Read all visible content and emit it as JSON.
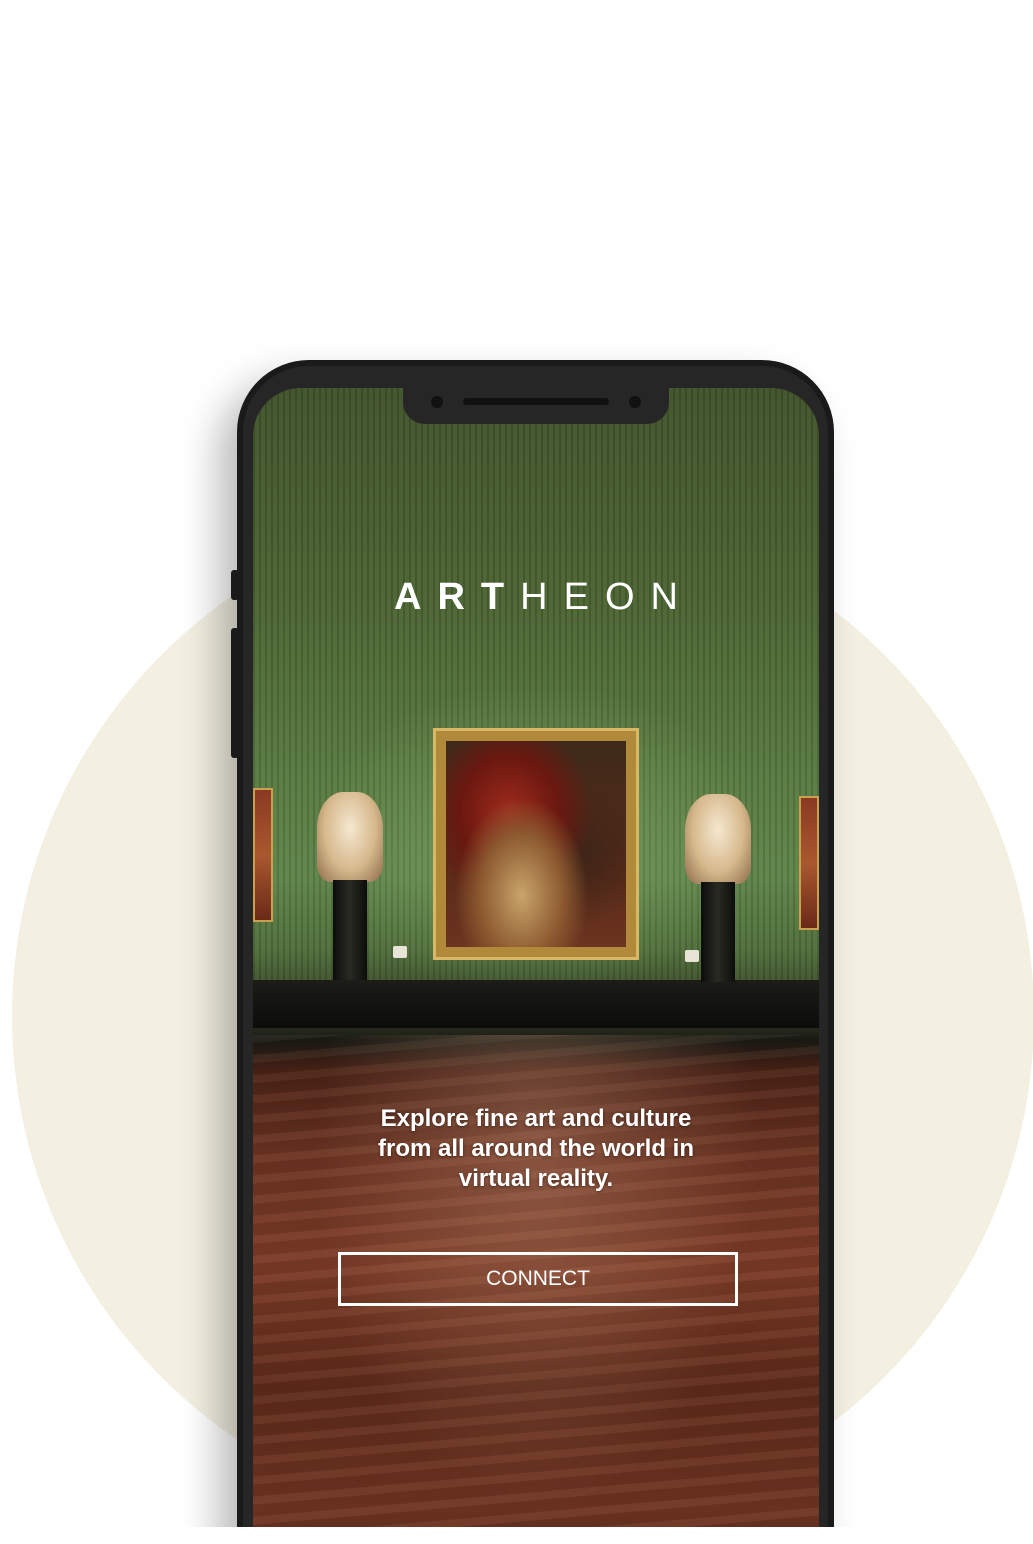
{
  "app": {
    "logo_strong": "ART",
    "logo_light": "HEON",
    "tagline": "Explore fine art and culture from all around the world in virtual reality.",
    "connect_label": "CONNECT"
  },
  "colors": {
    "backdrop": "#f3f0e2",
    "phone_body": "#1a1a1a",
    "text": "#ffffff"
  },
  "icons": [
    "front-camera-icon",
    "proximity-sensor-icon"
  ]
}
